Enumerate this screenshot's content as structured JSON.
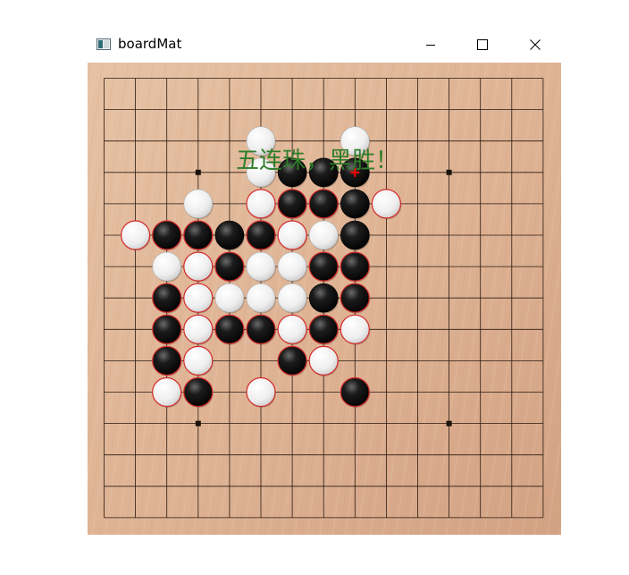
{
  "window": {
    "title": "boardMat",
    "controls": [
      "minimize",
      "maximize",
      "close"
    ]
  },
  "board": {
    "size": 15,
    "star_points": [
      [
        3,
        3
      ],
      [
        11,
        3
      ],
      [
        3,
        11
      ],
      [
        11,
        11
      ]
    ],
    "colors": {
      "wood_light": "#e6c2a4",
      "wood_dark": "#d2a283",
      "line": "#2a1a10",
      "last_move_marker": "#ff0000",
      "stone_ring": "#d42a2a"
    },
    "last_move": [
      8,
      3
    ],
    "stones": [
      {
        "col": 5,
        "row": 2,
        "color": "white",
        "ring": false
      },
      {
        "col": 8,
        "row": 2,
        "color": "white",
        "ring": false
      },
      {
        "col": 5,
        "row": 3,
        "color": "white",
        "ring": false
      },
      {
        "col": 6,
        "row": 3,
        "color": "black",
        "ring": false
      },
      {
        "col": 7,
        "row": 3,
        "color": "black",
        "ring": false
      },
      {
        "col": 8,
        "row": 3,
        "color": "black",
        "ring": false
      },
      {
        "col": 3,
        "row": 4,
        "color": "white",
        "ring": false
      },
      {
        "col": 5,
        "row": 4,
        "color": "white",
        "ring": true
      },
      {
        "col": 6,
        "row": 4,
        "color": "black",
        "ring": true
      },
      {
        "col": 7,
        "row": 4,
        "color": "black",
        "ring": true
      },
      {
        "col": 8,
        "row": 4,
        "color": "black",
        "ring": false
      },
      {
        "col": 9,
        "row": 4,
        "color": "white",
        "ring": true
      },
      {
        "col": 1,
        "row": 5,
        "color": "white",
        "ring": true
      },
      {
        "col": 2,
        "row": 5,
        "color": "black",
        "ring": true
      },
      {
        "col": 3,
        "row": 5,
        "color": "black",
        "ring": true
      },
      {
        "col": 4,
        "row": 5,
        "color": "black",
        "ring": false
      },
      {
        "col": 5,
        "row": 5,
        "color": "black",
        "ring": true
      },
      {
        "col": 6,
        "row": 5,
        "color": "white",
        "ring": true
      },
      {
        "col": 7,
        "row": 5,
        "color": "white",
        "ring": false
      },
      {
        "col": 8,
        "row": 5,
        "color": "black",
        "ring": false
      },
      {
        "col": 2,
        "row": 6,
        "color": "white",
        "ring": false
      },
      {
        "col": 3,
        "row": 6,
        "color": "white",
        "ring": true
      },
      {
        "col": 4,
        "row": 6,
        "color": "black",
        "ring": true
      },
      {
        "col": 5,
        "row": 6,
        "color": "white",
        "ring": false
      },
      {
        "col": 6,
        "row": 6,
        "color": "white",
        "ring": false
      },
      {
        "col": 7,
        "row": 6,
        "color": "black",
        "ring": true
      },
      {
        "col": 8,
        "row": 6,
        "color": "black",
        "ring": true
      },
      {
        "col": 2,
        "row": 7,
        "color": "black",
        "ring": true
      },
      {
        "col": 3,
        "row": 7,
        "color": "white",
        "ring": true
      },
      {
        "col": 4,
        "row": 7,
        "color": "white",
        "ring": false
      },
      {
        "col": 5,
        "row": 7,
        "color": "white",
        "ring": false
      },
      {
        "col": 6,
        "row": 7,
        "color": "white",
        "ring": false
      },
      {
        "col": 7,
        "row": 7,
        "color": "black",
        "ring": false
      },
      {
        "col": 8,
        "row": 7,
        "color": "black",
        "ring": true
      },
      {
        "col": 2,
        "row": 8,
        "color": "black",
        "ring": true
      },
      {
        "col": 3,
        "row": 8,
        "color": "white",
        "ring": true
      },
      {
        "col": 4,
        "row": 8,
        "color": "black",
        "ring": true
      },
      {
        "col": 5,
        "row": 8,
        "color": "black",
        "ring": true
      },
      {
        "col": 6,
        "row": 8,
        "color": "white",
        "ring": true
      },
      {
        "col": 7,
        "row": 8,
        "color": "black",
        "ring": true
      },
      {
        "col": 8,
        "row": 8,
        "color": "white",
        "ring": true
      },
      {
        "col": 2,
        "row": 9,
        "color": "black",
        "ring": true
      },
      {
        "col": 3,
        "row": 9,
        "color": "white",
        "ring": true
      },
      {
        "col": 6,
        "row": 9,
        "color": "black",
        "ring": true
      },
      {
        "col": 7,
        "row": 9,
        "color": "white",
        "ring": true
      },
      {
        "col": 2,
        "row": 10,
        "color": "white",
        "ring": true
      },
      {
        "col": 3,
        "row": 10,
        "color": "black",
        "ring": true
      },
      {
        "col": 5,
        "row": 10,
        "color": "white",
        "ring": true
      },
      {
        "col": 8,
        "row": 10,
        "color": "black",
        "ring": true
      }
    ]
  },
  "message": {
    "text": "五连珠，黑胜！",
    "color": "#2f7d2a"
  }
}
